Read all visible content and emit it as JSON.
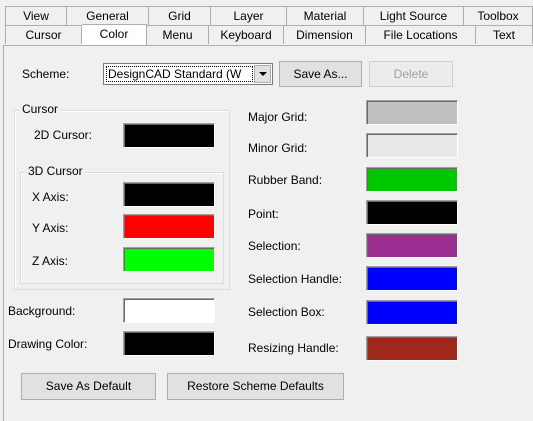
{
  "tabs_back": [
    "View",
    "General",
    "Grid",
    "Layer",
    "Material",
    "Light Source",
    "Toolbox"
  ],
  "tabs_front": [
    "Cursor",
    "Color",
    "Menu",
    "Keyboard",
    "Dimension",
    "File Locations",
    "Text"
  ],
  "active_tab": "Color",
  "scheme": {
    "label": "Scheme:",
    "value": "DesignCAD Standard (W",
    "save_as": "Save As...",
    "delete": "Delete"
  },
  "cursor_group": {
    "title": "Cursor",
    "cursor_2d": "2D Cursor:",
    "sub_title": "3D Cursor",
    "x_axis": "X Axis:",
    "y_axis": "Y Axis:",
    "z_axis": "Z Axis:"
  },
  "background_label": "Background:",
  "drawing_color_label": "Drawing Color:",
  "right_labels": {
    "major_grid": "Major Grid:",
    "minor_grid": "Minor Grid:",
    "rubber_band": "Rubber Band:",
    "point": "Point:",
    "selection": "Selection:",
    "selection_handle": "Selection Handle:",
    "selection_box": "Selection Box:",
    "resizing_handle": "Resizing Handle:"
  },
  "colors": {
    "cursor_2d": "#000000",
    "x_axis": "#000000",
    "y_axis": "#ff0000",
    "z_axis": "#00ff00",
    "background": "#ffffff",
    "drawing_color": "#000000",
    "major_grid": "#c0c0c0",
    "minor_grid": "#e8e8e8",
    "rubber_band": "#00c800",
    "point": "#000000",
    "selection": "#9b2d91",
    "selection_handle": "#0000ff",
    "selection_box": "#0000ff",
    "resizing_handle": "#a02818"
  },
  "buttons": {
    "save_as_default": "Save As Default",
    "restore_defaults": "Restore Scheme Defaults"
  }
}
